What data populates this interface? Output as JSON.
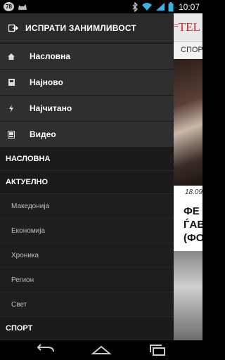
{
  "status_bar": {
    "notification_count": "78",
    "time": "10:07",
    "icons": [
      "notification-badge-icon",
      "cat-icon",
      "bluetooth-icon",
      "wifi-icon",
      "signal-icon",
      "battery-icon"
    ]
  },
  "drawer": {
    "send_item": {
      "label": "ИСПРАТИ ЗАНИМЛИВОСТ",
      "icon": "send-icon"
    },
    "nav_items": [
      {
        "label": "Насловна",
        "icon": "home-icon"
      },
      {
        "label": "Најново",
        "icon": "newest-icon"
      },
      {
        "label": "Најчитано",
        "icon": "bolt-icon"
      },
      {
        "label": "Видео",
        "icon": "video-icon"
      }
    ],
    "sections": [
      {
        "label": "НАСЛОВНА"
      },
      {
        "label": "АКТУЕЛНО",
        "items": [
          "Македонија",
          "Економија",
          "Хроника",
          "Регион",
          "Свет"
        ]
      },
      {
        "label": "СПОРТ"
      }
    ]
  },
  "article_peek": {
    "logo": "TEL",
    "tab": "СПОР",
    "date": "18.09",
    "title_lines": [
      "ФЕ",
      "ЃАВ",
      "(ФО"
    ]
  },
  "colors": {
    "drawer_bg": "#1e1e1e",
    "nav_item_bg": "#2f2f2f",
    "brand_red": "#d32027"
  }
}
